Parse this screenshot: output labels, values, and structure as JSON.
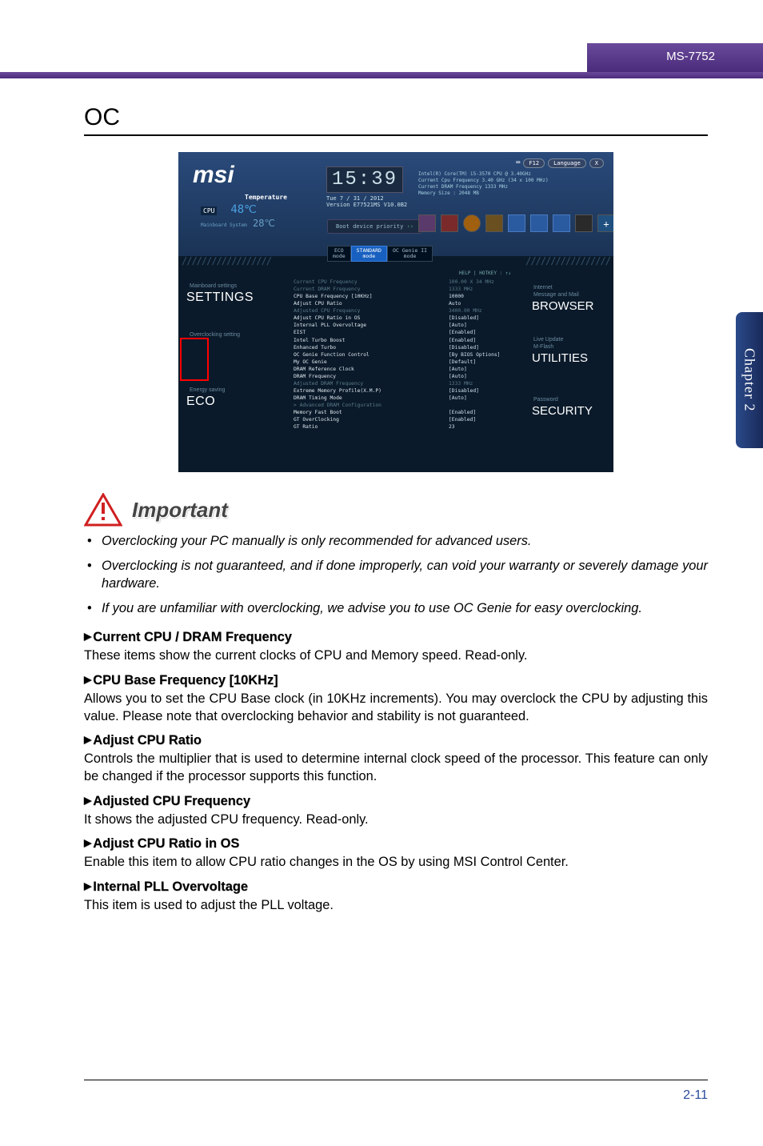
{
  "doc_id": "MS-7752",
  "side_tab": "Chapter 2",
  "page_number": "2-11",
  "page_title": "OC",
  "bios": {
    "logo": "msi",
    "temperature_label": "Temperature",
    "cpu_label": "CPU",
    "cpu_temp": "48℃",
    "sys_label": "Mainboard System",
    "sys_temp": "28℃",
    "time": "15:39",
    "date": "Tue  7 / 31 / 2012",
    "version": "Version E77521MS V10.0B2",
    "sysinfo": [
      "Intel(R) Core(TM) i5-3570 CPU @ 3.40GHz",
      "Current Cpu Frequency 3.40 GHz (34 x 100 MHz)",
      "Current DRAM Frequency 1333 MHz",
      "Memory Size : 2048 MB"
    ],
    "top_buttons": {
      "screenshot": "F12",
      "lang": "Language",
      "close": "X"
    },
    "boot_priority": "Boot device priority",
    "mode_tabs": [
      "ECO\nmode",
      "STANDARD\nmode",
      "OC Genie II\nmode"
    ],
    "mode_active_index": 1,
    "help_hotkey": "HELP | HOTKEY : ↑↓",
    "left_nav": {
      "mainboard": "Mainboard settings",
      "settings": "SETTINGS",
      "overclocking": "Overclocking setting",
      "energy": "Energy saving",
      "eco": "ECO"
    },
    "right_nav": {
      "internet": "Internet",
      "messaging": "Message and Mail",
      "browser": "BROWSER",
      "live": "Live Update",
      "mflash": "M-Flash",
      "utilities": "UTILITIES",
      "password": "Password",
      "security": "SECURITY"
    },
    "rows": [
      {
        "k": "Current CPU Frequency",
        "v": "100.00 X 34 MHz",
        "muted": true
      },
      {
        "k": "Current DRAM Frequency",
        "v": "1333 MHz",
        "muted": true
      },
      {
        "k": "CPU Base Frequency [10KHz]",
        "v": "10000"
      },
      {
        "k": "Adjust CPU Ratio",
        "v": "Auto"
      },
      {
        "k": "Adjusted CPU Frequency",
        "v": "3400.00 MHz",
        "muted": true
      },
      {
        "k": "Adjust CPU Ratio in OS",
        "v": "[Disabled]"
      },
      {
        "k": "Internal PLL Overvoltage",
        "v": "[Auto]"
      },
      {
        "k": "EIST",
        "v": "[Enabled]"
      },
      {
        "k": "Intel Turbo Boost",
        "v": "[Enabled]"
      },
      {
        "k": "Enhanced Turbo",
        "v": "[Disabled]"
      },
      {
        "k": "OC Genie Function Control",
        "v": "[By BIOS Options]"
      },
      {
        "k": "My OC Genie",
        "v": "[Default]"
      },
      {
        "k": "DRAM Reference Clock",
        "v": "[Auto]"
      },
      {
        "k": "DRAM Frequency",
        "v": "[Auto]"
      },
      {
        "k": "Adjusted DRAM Frequency",
        "v": "1333 MHz",
        "muted": true
      },
      {
        "k": "Extreme Memory Profile(X.M.P)",
        "v": "[Disabled]"
      },
      {
        "k": "DRAM Timing Mode",
        "v": "[Auto]"
      },
      {
        "k": "Advanced DRAM Configuration",
        "v": "",
        "muted": true,
        "caret": true
      },
      {
        "k": "Memory Fast Boot",
        "v": "[Enabled]"
      },
      {
        "k": "GT OverClocking",
        "v": "[Enabled]"
      },
      {
        "k": "GT Ratio",
        "v": "23"
      }
    ]
  },
  "important_label": "Important",
  "bullets": [
    "Overclocking your PC manually is only recommended for advanced users.",
    "Overclocking is not guaranteed, and if done improperly, can void your warranty or severely damage your hardware.",
    "If you are unfamiliar with overclocking, we advise you to use OC Genie for easy overclocking."
  ],
  "sections": [
    {
      "heading": "Current CPU / DRAM Frequency",
      "body": "These items show the current clocks of CPU and Memory speed. Read-only."
    },
    {
      "heading": "CPU Base Frequency [10KHz]",
      "body": "Allows you to set the CPU Base clock (in 10KHz increments). You may overclock the CPU by adjusting this value. Please note that overclocking behavior and stability is not guaranteed."
    },
    {
      "heading": "Adjust CPU Ratio",
      "body": "Controls the multiplier that is used to determine internal clock speed of the processor. This feature can only be changed if the processor supports this function."
    },
    {
      "heading": "Adjusted CPU Frequency",
      "body": "It shows the adjusted CPU frequency. Read-only."
    },
    {
      "heading": "Adjust CPU Ratio in OS",
      "body": "Enable this item to allow CPU ratio changes in the OS by using MSI Control Center."
    },
    {
      "heading": "Internal PLL Overvoltage",
      "body": "This item is used to adjust the PLL voltage."
    }
  ]
}
